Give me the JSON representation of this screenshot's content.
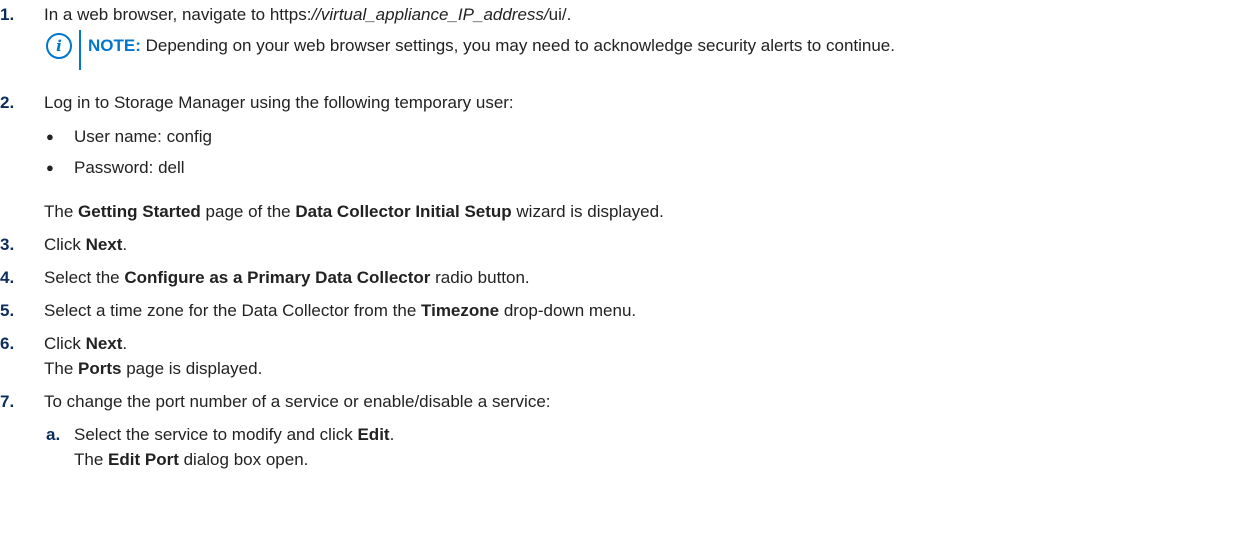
{
  "steps": [
    {
      "num": "1.",
      "pre": "In a web browser, navigate to https:",
      "italic": "//virtual_appliance_IP_address/",
      "post": "ui/."
    },
    {
      "num": "2.",
      "text": "Log in to Storage Manager using the following temporary user:"
    },
    {
      "num": "3.",
      "pre": "Click ",
      "bold": "Next",
      "post": "."
    },
    {
      "num": "4.",
      "pre": "Select the ",
      "bold": "Configure as a Primary Data Collector",
      "post": " radio button."
    },
    {
      "num": "5.",
      "pre": "Select a time zone for the Data Collector from the ",
      "bold": "Timezone",
      "post": " drop-down menu."
    },
    {
      "num": "6.",
      "pre": "Click ",
      "bold": "Next",
      "post": "."
    },
    {
      "num": "7.",
      "text": "To change the port number of a service or enable/disable a service:"
    }
  ],
  "note": {
    "icon": "info-icon",
    "label": "NOTE:",
    "text": " Depending on your web browser settings, you may need to acknowledge security alerts to continue."
  },
  "step2_bullets": [
    "User name: config",
    "Password: dell"
  ],
  "step2_result": {
    "pre": "The ",
    "bold1": "Getting Started",
    "mid": " page of the ",
    "bold2": "Data Collector Initial Setup",
    "post": " wizard is displayed."
  },
  "step6_result": {
    "pre": "The ",
    "bold": "Ports",
    "post": " page is displayed."
  },
  "step7_sub": {
    "letter": "a.",
    "pre": "Select the service to modify and click ",
    "bold": "Edit",
    "post": ".",
    "result_pre": "The ",
    "result_bold": "Edit Port",
    "result_post": " dialog box open."
  },
  "bullet_char": "●",
  "info_glyph": "i"
}
